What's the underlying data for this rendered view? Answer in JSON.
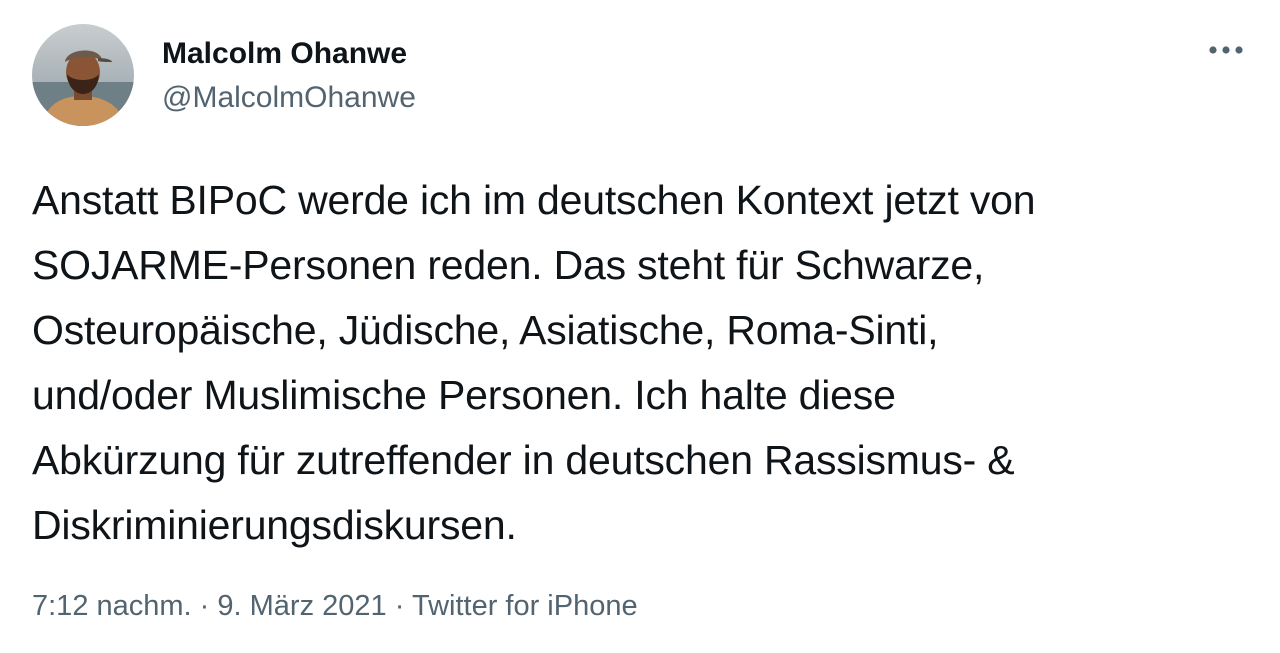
{
  "author": {
    "display_name": "Malcolm Ohanwe",
    "handle": "@MalcolmOhanwe",
    "avatar_icon": "profile-photo"
  },
  "tweet": {
    "text": "Anstatt BIPoC werde ich im deutschen Kontext jetzt von\nSOJARME-Personen reden. Das steht für Schwarze,\nOsteuropäische, Jüdische, Asiatische, Roma-Sinti,\nund/oder Muslimische Personen. Ich halte diese\nAbkürzung für zutreffender in deutschen Rassismus- &\nDiskriminierungsdiskursen."
  },
  "meta": {
    "time": "7:12 nachm.",
    "separator": "·",
    "date": "9. März 2021",
    "source": "Twitter for iPhone"
  },
  "icons": {
    "more": "more-options-icon"
  },
  "colors": {
    "text": "#0f1419",
    "secondary": "#536471",
    "background": "#ffffff"
  }
}
